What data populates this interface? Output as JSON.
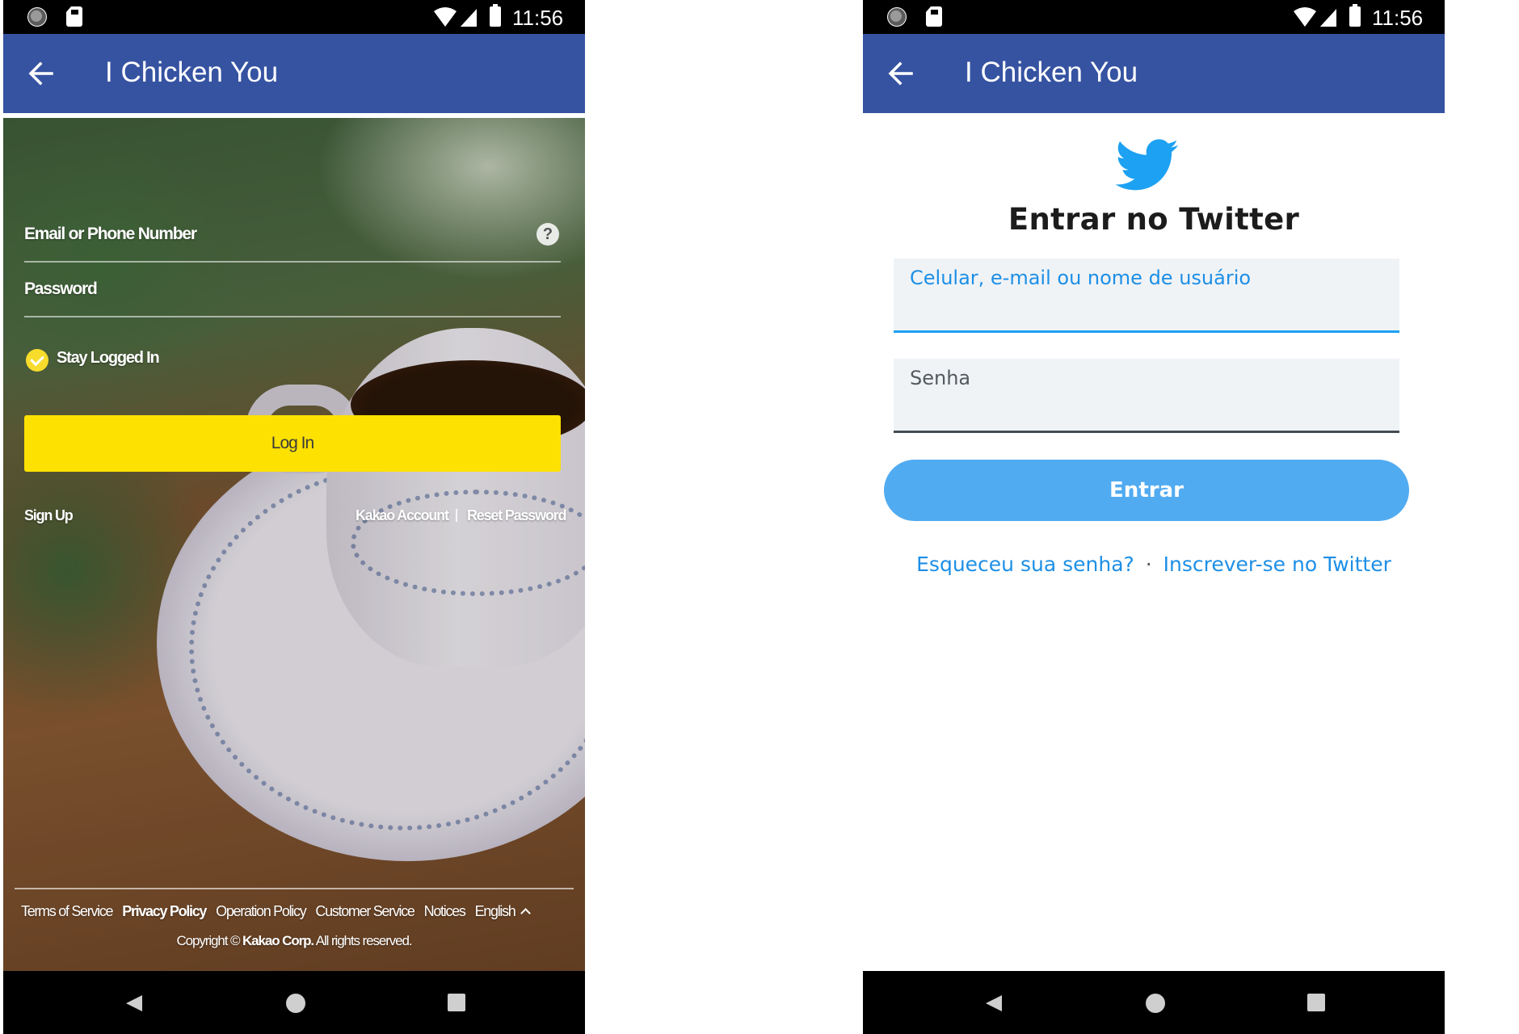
{
  "status_bar": {
    "time": "11:56"
  },
  "app_bar": {
    "title": "I Chicken You"
  },
  "kakao": {
    "email_label": "Email or Phone Number",
    "help_icon": "?",
    "password_label": "Password",
    "stay_logged_in": "Stay Logged In",
    "login_button": "Log In",
    "sign_up": "Sign Up",
    "kakao_account": "Kakao Account",
    "reset_password": "Reset Password",
    "footer_links": [
      "Terms of Service",
      "Privacy Policy",
      "Operation Policy",
      "Customer Service",
      "Notices",
      "English"
    ],
    "copyright_prefix": "Copyright ©",
    "copyright_company": "Kakao Corp.",
    "copyright_suffix": "All rights reserved.",
    "colors": {
      "login_button": "#fde100",
      "check": "#f8dc2b"
    }
  },
  "twitter": {
    "icon": "twitter-bird-icon",
    "heading": "Entrar no Twitter",
    "username_placeholder": "Celular, e-mail ou nome de usuário",
    "password_placeholder": "Senha",
    "submit_button": "Entrar",
    "forgot_password": "Esqueceu sua senha?",
    "separator": "·",
    "signup_link": "Inscrever-se no Twitter",
    "colors": {
      "brand": "#1da1f2",
      "button": "#51abf1",
      "app_bar": "#3653a2"
    }
  }
}
